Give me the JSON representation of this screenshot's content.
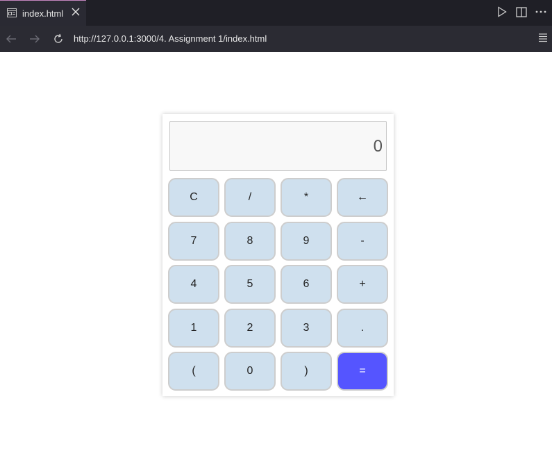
{
  "browser": {
    "tab_title": "index.html",
    "url": "http://127.0.0.1:3000/4. Assignment 1/index.html",
    "icons": {
      "tab": "browser-preview-icon",
      "close": "close-icon",
      "run": "play-icon",
      "split": "split-editor-icon",
      "more": "more-horizontal-icon",
      "back": "arrow-left-icon",
      "forward": "arrow-right-icon",
      "reload": "reload-icon",
      "menu": "menu-icon"
    }
  },
  "calculator": {
    "display_value": "0",
    "keys": [
      {
        "label": "C",
        "name": "clear-button"
      },
      {
        "label": "/",
        "name": "divide-button"
      },
      {
        "label": "*",
        "name": "multiply-button"
      },
      {
        "label": "←",
        "name": "backspace-button"
      },
      {
        "label": "7",
        "name": "digit-7-button"
      },
      {
        "label": "8",
        "name": "digit-8-button"
      },
      {
        "label": "9",
        "name": "digit-9-button"
      },
      {
        "label": "-",
        "name": "subtract-button"
      },
      {
        "label": "4",
        "name": "digit-4-button"
      },
      {
        "label": "5",
        "name": "digit-5-button"
      },
      {
        "label": "6",
        "name": "digit-6-button"
      },
      {
        "label": "+",
        "name": "add-button"
      },
      {
        "label": "1",
        "name": "digit-1-button"
      },
      {
        "label": "2",
        "name": "digit-2-button"
      },
      {
        "label": "3",
        "name": "digit-3-button"
      },
      {
        "label": ".",
        "name": "decimal-button"
      },
      {
        "label": "(",
        "name": "open-paren-button"
      },
      {
        "label": "0",
        "name": "digit-0-button"
      },
      {
        "label": ")",
        "name": "close-paren-button"
      },
      {
        "label": "=",
        "name": "equals-button"
      }
    ],
    "colors": {
      "key_bg": "#cfe0ee",
      "equals_bg": "#5555ff"
    }
  }
}
